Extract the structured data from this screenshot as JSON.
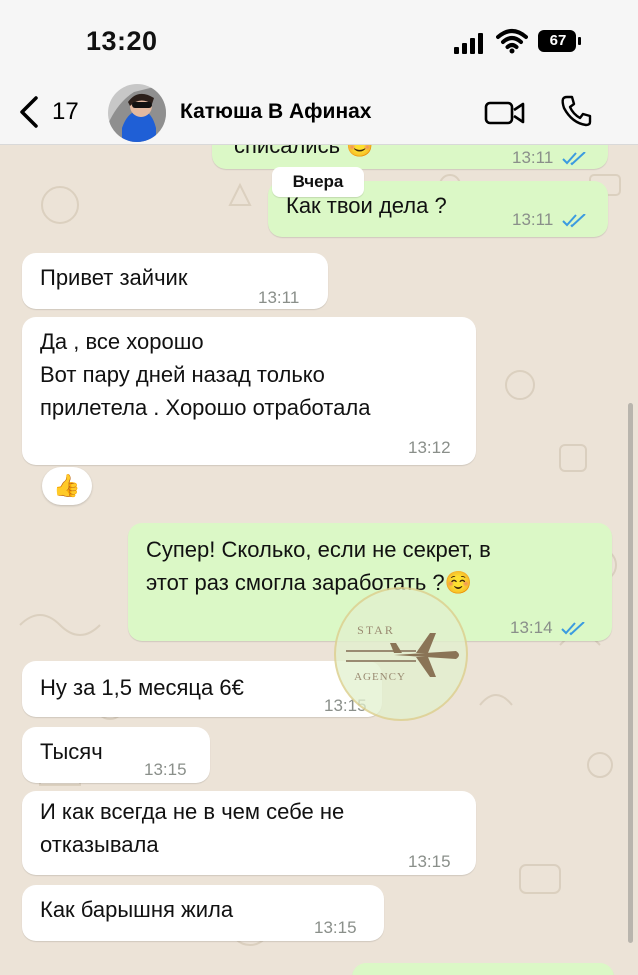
{
  "status_bar": {
    "time": "13:20",
    "battery": "67"
  },
  "header": {
    "back_count": "17",
    "contact_name": "Катюша В Афинах"
  },
  "date_label": "Вчера",
  "messages": [
    {
      "text": "списались 😊",
      "time": "13:11",
      "direction": "outgoing"
    },
    {
      "text": "Как твои дела ?",
      "time": "13:11",
      "direction": "outgoing"
    },
    {
      "text": "Привет зайчик",
      "time": "13:11",
      "direction": "incoming"
    },
    {
      "text": "Да , все хорошо\nВот пару дней назад только\nприлетела . Хорошо отработала",
      "time": "13:12",
      "direction": "incoming",
      "reaction": "👍"
    },
    {
      "text": "Супер! Сколько, если не секрет, в\nэтот раз смогла заработать ?☺️",
      "time": "13:14",
      "direction": "outgoing"
    },
    {
      "text": "Ну за 1,5 месяца 6€",
      "time": "13:15",
      "direction": "incoming"
    },
    {
      "text": "Тысяч",
      "time": "13:15",
      "direction": "incoming"
    },
    {
      "text": "И как всегда не в чем себе не\nотказывала",
      "time": "13:15",
      "direction": "incoming"
    },
    {
      "text": "Как барышня жила",
      "time": "13:15",
      "direction": "incoming"
    }
  ],
  "watermark": {
    "top": "STAR",
    "bottom": "AGENCY"
  },
  "colors": {
    "outgoing_bubble": "#dbf8c6",
    "incoming_bubble": "#ffffff",
    "read_ticks": "#3b9be0",
    "accent": "#000000"
  }
}
